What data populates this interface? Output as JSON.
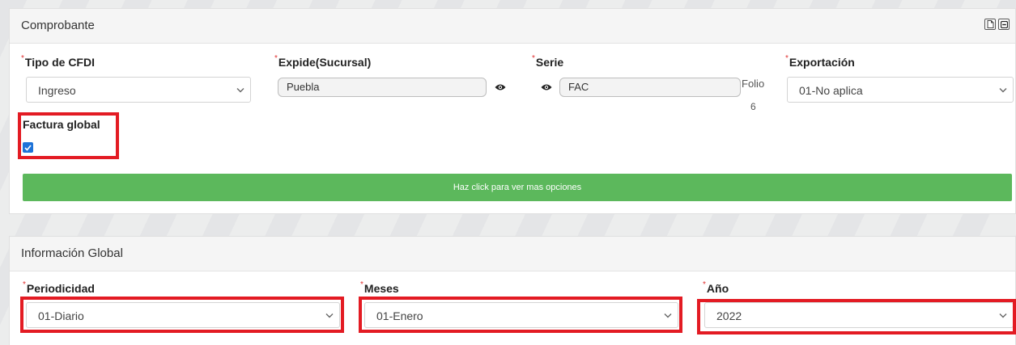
{
  "comprobante": {
    "title": "Comprobante",
    "required_mark": "*",
    "tipo_cfdi": {
      "label": "Tipo de CFDI",
      "value": "Ingreso"
    },
    "expide": {
      "label": "Expide(Sucursal)",
      "value": "Puebla"
    },
    "serie": {
      "label": "Serie",
      "value": "FAC"
    },
    "folio": {
      "label": "Folio",
      "value": "6"
    },
    "exportacion": {
      "label": "Exportación",
      "value": "01-No aplica"
    },
    "factura_global": {
      "label": "Factura global",
      "checked": true
    },
    "more_options_label": "Haz click para ver mas opciones",
    "more_options_color": "#5cb85c"
  },
  "informacion_global": {
    "title": "Información Global",
    "periodicidad": {
      "label": "Periodicidad",
      "value": "01-Diario"
    },
    "meses": {
      "label": "Meses",
      "value": "01-Enero"
    },
    "anio": {
      "label": "Año",
      "value": "2022"
    }
  },
  "highlight_color": "#e31b23",
  "icons": [
    "document-icon",
    "collapse-icon",
    "eye-icon",
    "chevron-down-icon",
    "checkmark-icon"
  ]
}
